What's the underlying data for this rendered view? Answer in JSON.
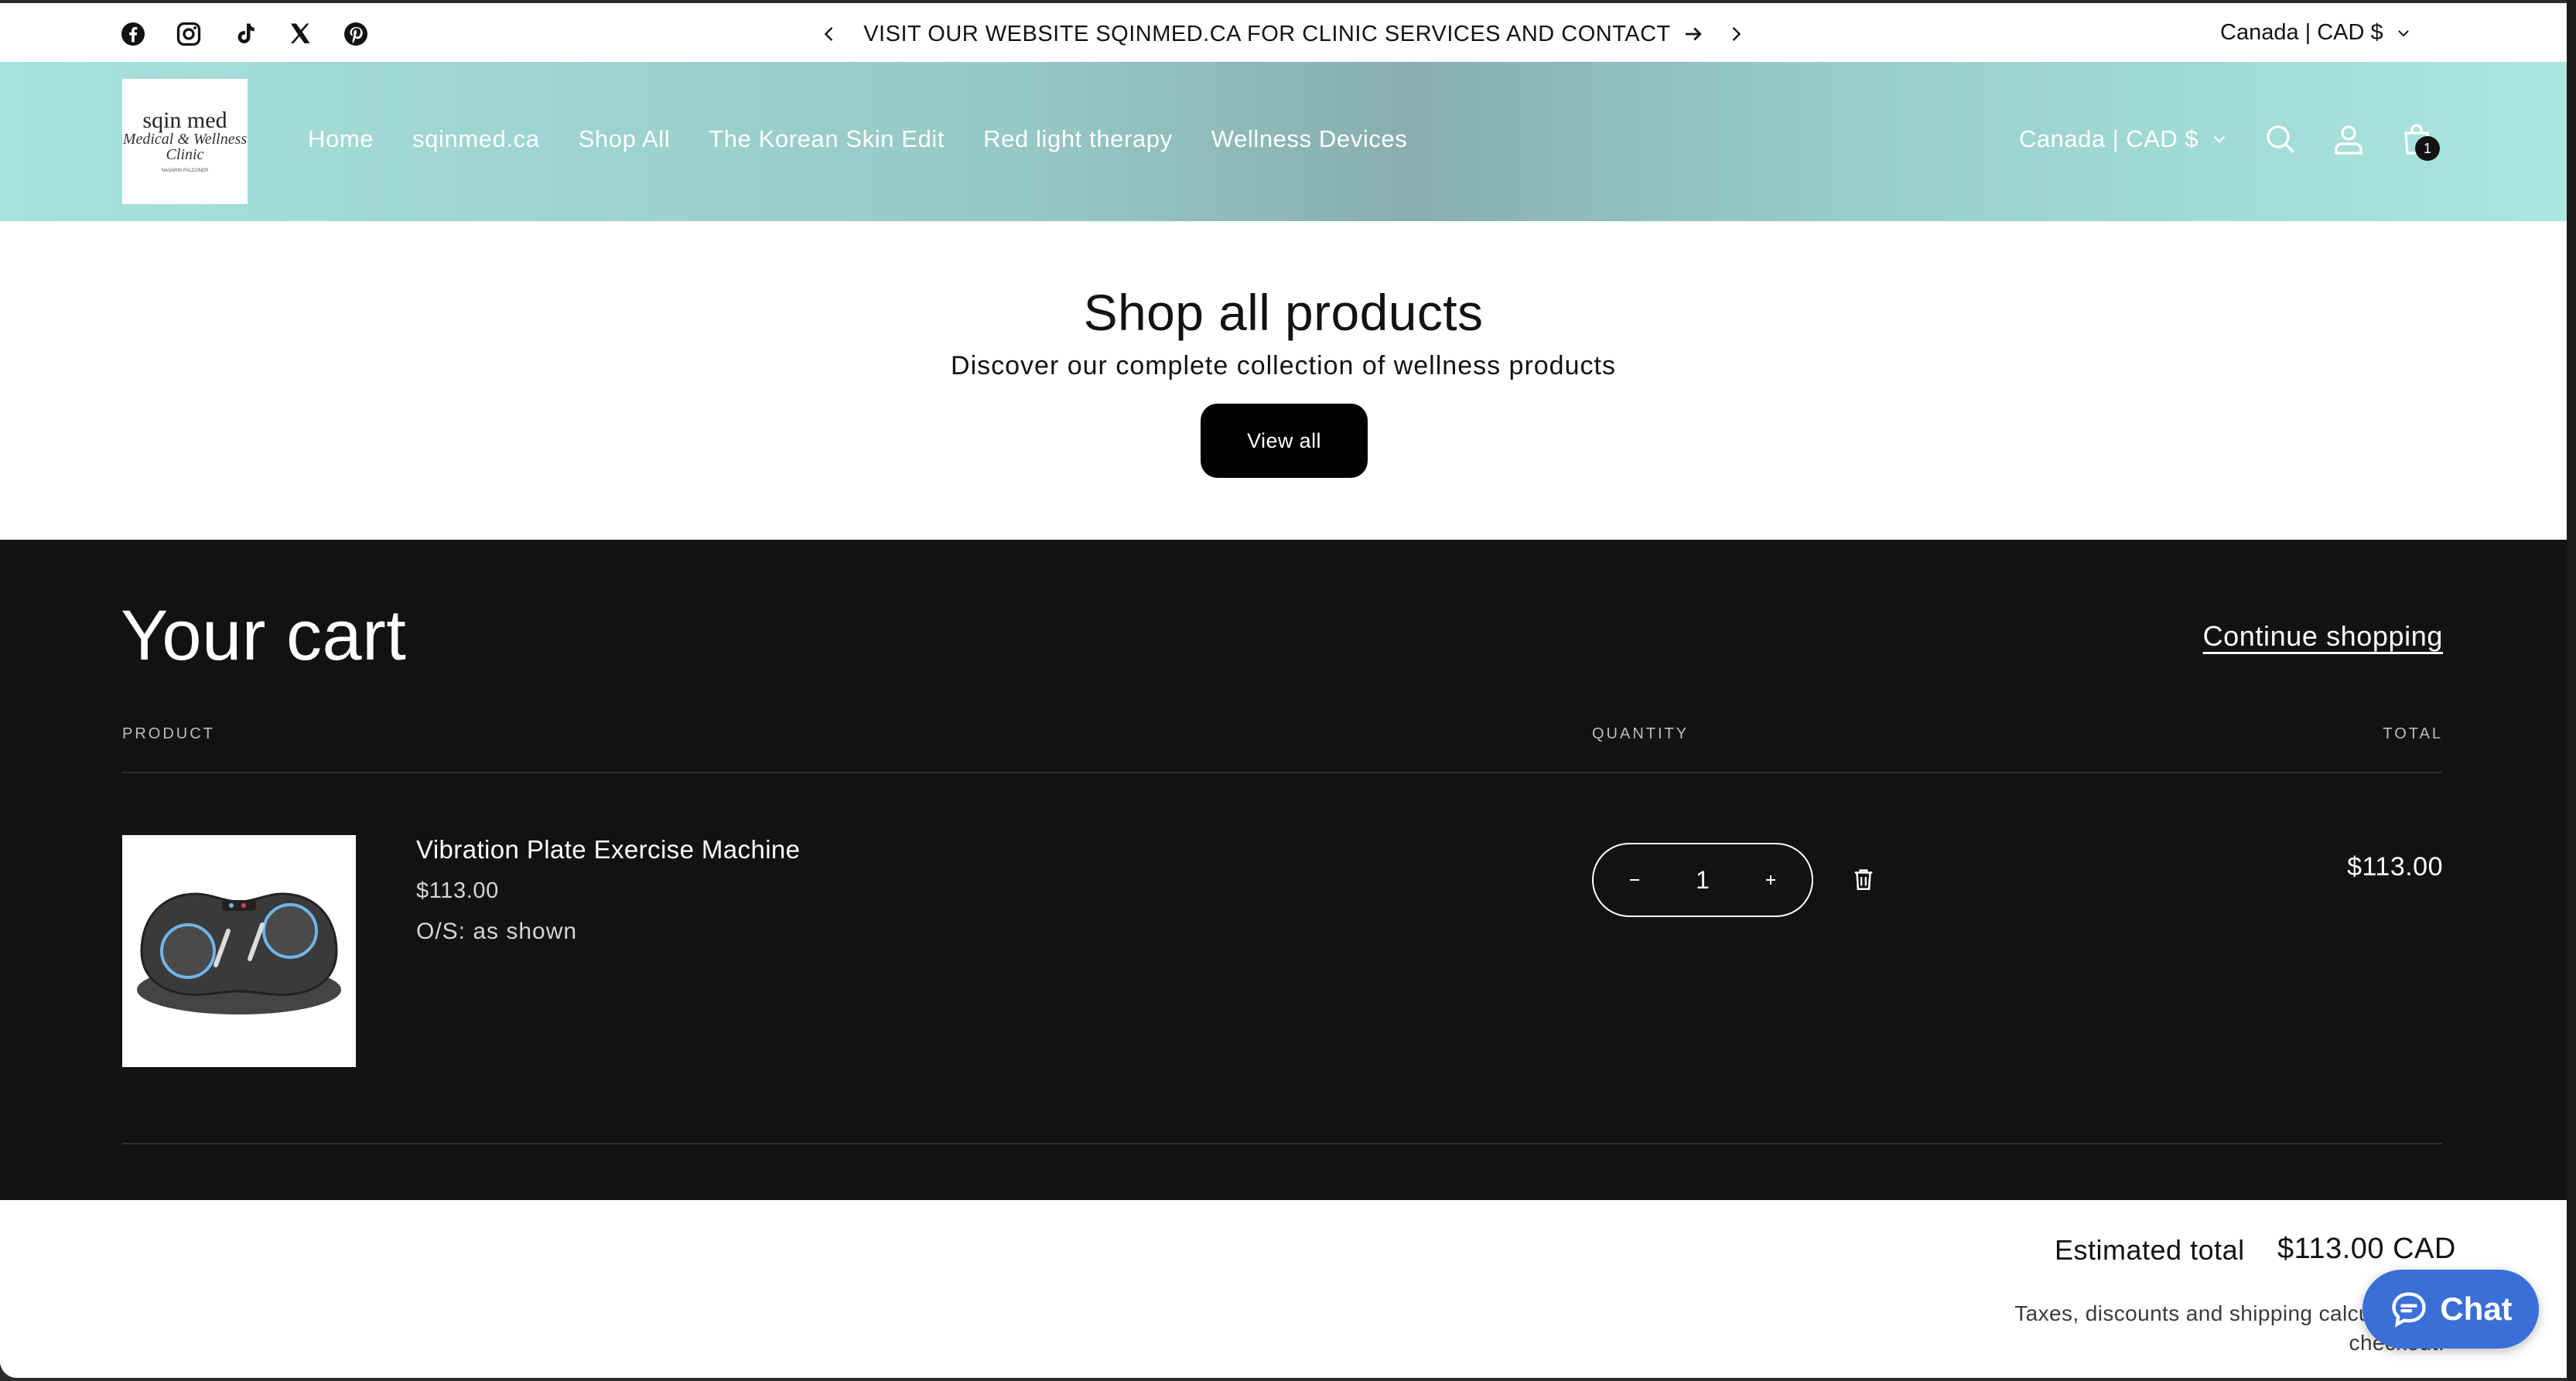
{
  "announcement": {
    "text": "VISIT OUR WEBSITE SQINMED.CA FOR CLINIC SERVICES AND CONTACT",
    "country": "Canada | CAD $"
  },
  "socials": [
    "facebook-icon",
    "instagram-icon",
    "tiktok-icon",
    "x-icon",
    "pinterest-icon"
  ],
  "logo": {
    "line1": "sqin med",
    "line2": "Medical & Wellness",
    "line3": "Clinic",
    "line4": "NASARIN FALCONER"
  },
  "nav": {
    "items": [
      "Home",
      "sqinmed.ca",
      "Shop All",
      "The Korean Skin Edit",
      "Red light therapy",
      "Wellness Devices"
    ]
  },
  "header": {
    "country": "Canada | CAD $",
    "cart_count": "1"
  },
  "hero": {
    "title": "Shop all products",
    "subtitle": "Discover our complete collection of wellness products",
    "button": "View all"
  },
  "cart": {
    "title": "Your cart",
    "continue": "Continue shopping",
    "columns": {
      "product": "PRODUCT",
      "quantity": "QUANTITY",
      "total": "TOTAL"
    },
    "item": {
      "name": "Vibration Plate Exercise Machine",
      "price": "$113.00",
      "option": "O/S: as shown",
      "quantity": "1",
      "total": "$113.00"
    }
  },
  "summary": {
    "label": "Estimated total",
    "value": "$113.00 CAD",
    "note": "Taxes, discounts and shipping calculated at checkout."
  },
  "chat": {
    "label": "Chat"
  },
  "colors": {
    "accent": "#3b6fd8",
    "header_teal": "#a7e2dd",
    "cart_bg": "#121212"
  }
}
